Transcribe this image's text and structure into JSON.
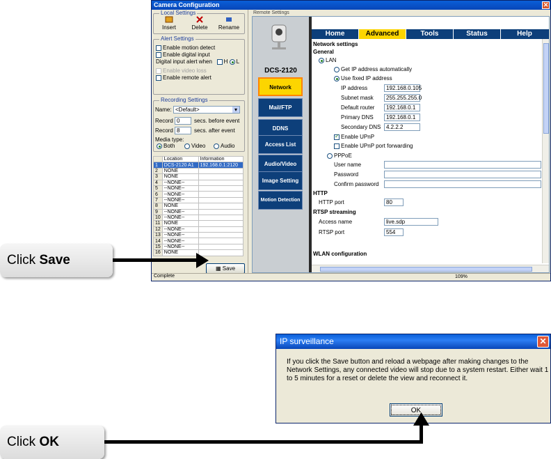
{
  "window": {
    "title": "Camera Configuration",
    "status": "Complete",
    "zoom": "109%"
  },
  "local": {
    "group_title": "Local Settings",
    "toolbar": [
      {
        "label": "Insert"
      },
      {
        "label": "Delete"
      },
      {
        "label": "Rename"
      }
    ],
    "alert": {
      "title": "Alert Settings",
      "enable_motion": "Enable motion detect",
      "enable_digital": "Enable digital input",
      "digital_alert_label": "Digital input alert when",
      "high": "H",
      "low": "L",
      "enable_video_loss": "Enable video loss",
      "enable_remote": "Enable remote alert"
    },
    "recording": {
      "title": "Recording Settings",
      "name_label": "Name:",
      "name_value": "<Default>",
      "record_before_label": "Record",
      "record_before_value": "0",
      "record_before_suffix": "secs. before event",
      "record_after_label": "Record",
      "record_after_value": "8",
      "record_after_suffix": "secs. after event",
      "media_label": "Media type:",
      "media_options": [
        "Both",
        "Video",
        "Audio"
      ]
    },
    "table": {
      "headers": [
        "Location",
        "Information"
      ],
      "rows": [
        [
          "1",
          "DCS-2120  A1",
          "192.168.0.1:2120"
        ],
        [
          "2",
          "NONE",
          ""
        ],
        [
          "3",
          "NONE",
          ""
        ],
        [
          "4",
          "--NONE--",
          ""
        ],
        [
          "5",
          "--NONE--",
          ""
        ],
        [
          "6",
          "--NONE--",
          ""
        ],
        [
          "7",
          "--NONE--",
          ""
        ],
        [
          "8",
          "NONE",
          ""
        ],
        [
          "9",
          "--NONE--",
          ""
        ],
        [
          "10",
          "--NONE--",
          ""
        ],
        [
          "11",
          "NONE",
          ""
        ],
        [
          "12",
          "--NONE--",
          ""
        ],
        [
          "13",
          "--NONE--",
          ""
        ],
        [
          "14",
          "--NONE--",
          ""
        ],
        [
          "15",
          "--NONE--",
          ""
        ],
        [
          "16",
          "NONE",
          ""
        ]
      ]
    },
    "save": "Save"
  },
  "remote": {
    "label": "Remote Settings",
    "model": "DCS-2120",
    "nav": [
      "Network",
      "Mail/FTP",
      "DDNS",
      "Access List",
      "Audio/Video",
      "Image Setting",
      "Motion Detection"
    ],
    "tabs": [
      "Home",
      "Advanced",
      "Tools",
      "Status",
      "Help"
    ],
    "network": {
      "title": "Network settings",
      "general": "General",
      "lan": "LAN",
      "get_auto": "Get IP address automatically",
      "use_fixed": "Use fixed IP address",
      "ip_label": "IP address",
      "ip": "192.168.0.105",
      "mask_label": "Subnet mask",
      "mask": "255.255.255.0",
      "router_label": "Default router",
      "router": "192.168.0.1",
      "dns1_label": "Primary DNS",
      "dns1": "192.168.0.1",
      "dns2_label": "Secondary DNS",
      "dns2": "4.2.2.2",
      "upnp": "Enable UPnP",
      "upnp_fwd": "Enable UPnP port forwarding",
      "pppoe": "PPPoE",
      "user_label": "User name",
      "pass_label": "Password",
      "confirm_label": "Confirm password",
      "http": "HTTP",
      "http_port_label": "HTTP port",
      "http_port": "80",
      "rtsp": "RTSP streaming",
      "access_label": "Access name",
      "access": "live.sdp",
      "rtsp_port_label": "RTSP port",
      "rtsp_port": "554",
      "wlan": "WLAN configuration"
    }
  },
  "callouts": {
    "save_pre": "Click ",
    "save_bold": "Save",
    "ok_pre": "Click ",
    "ok_bold": "OK"
  },
  "dialog": {
    "title": "IP surveillance",
    "message": "If you click the Save button and reload a webpage after making changes to the Network Settings, any connected video will stop due to a system restart. Either wait 1 to 5 minutes for a reset or delete the view and reconnect it.",
    "ok": "OK"
  }
}
